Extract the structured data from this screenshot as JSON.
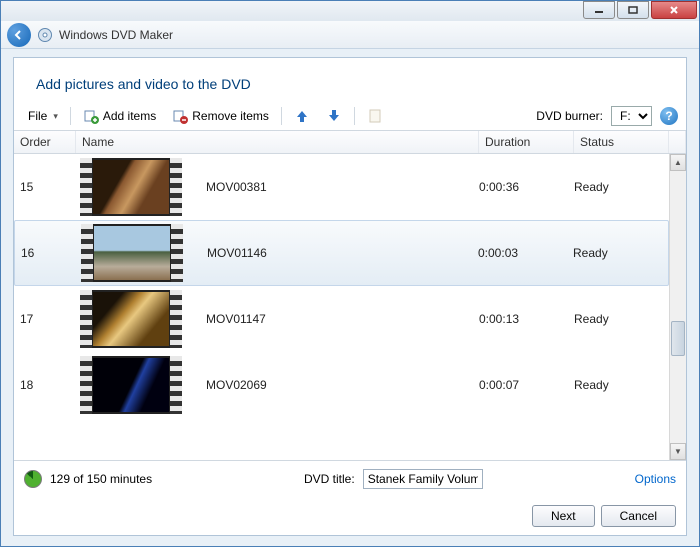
{
  "window": {
    "app_title": "Windows DVD Maker"
  },
  "heading": "Add pictures and video to the DVD",
  "toolbar": {
    "file_label": "File",
    "add_label": "Add items",
    "remove_label": "Remove items",
    "burner_label": "DVD burner:",
    "burner_value": "F:"
  },
  "columns": {
    "order": "Order",
    "name": "Name",
    "duration": "Duration",
    "status": "Status"
  },
  "rows": [
    {
      "order": "15",
      "name": "MOV00381",
      "duration": "0:00:36",
      "status": "Ready",
      "thumb": "t1",
      "selected": false
    },
    {
      "order": "16",
      "name": "MOV01146",
      "duration": "0:00:03",
      "status": "Ready",
      "thumb": "t2",
      "selected": true
    },
    {
      "order": "17",
      "name": "MOV01147",
      "duration": "0:00:13",
      "status": "Ready",
      "thumb": "t3",
      "selected": false
    },
    {
      "order": "18",
      "name": "MOV02069",
      "duration": "0:00:07",
      "status": "Ready",
      "thumb": "t4",
      "selected": false
    }
  ],
  "status": {
    "minutes": "129 of 150 minutes",
    "title_label": "DVD title:",
    "title_value": "Stanek Family Volum",
    "options": "Options"
  },
  "buttons": {
    "next": "Next",
    "cancel": "Cancel"
  }
}
